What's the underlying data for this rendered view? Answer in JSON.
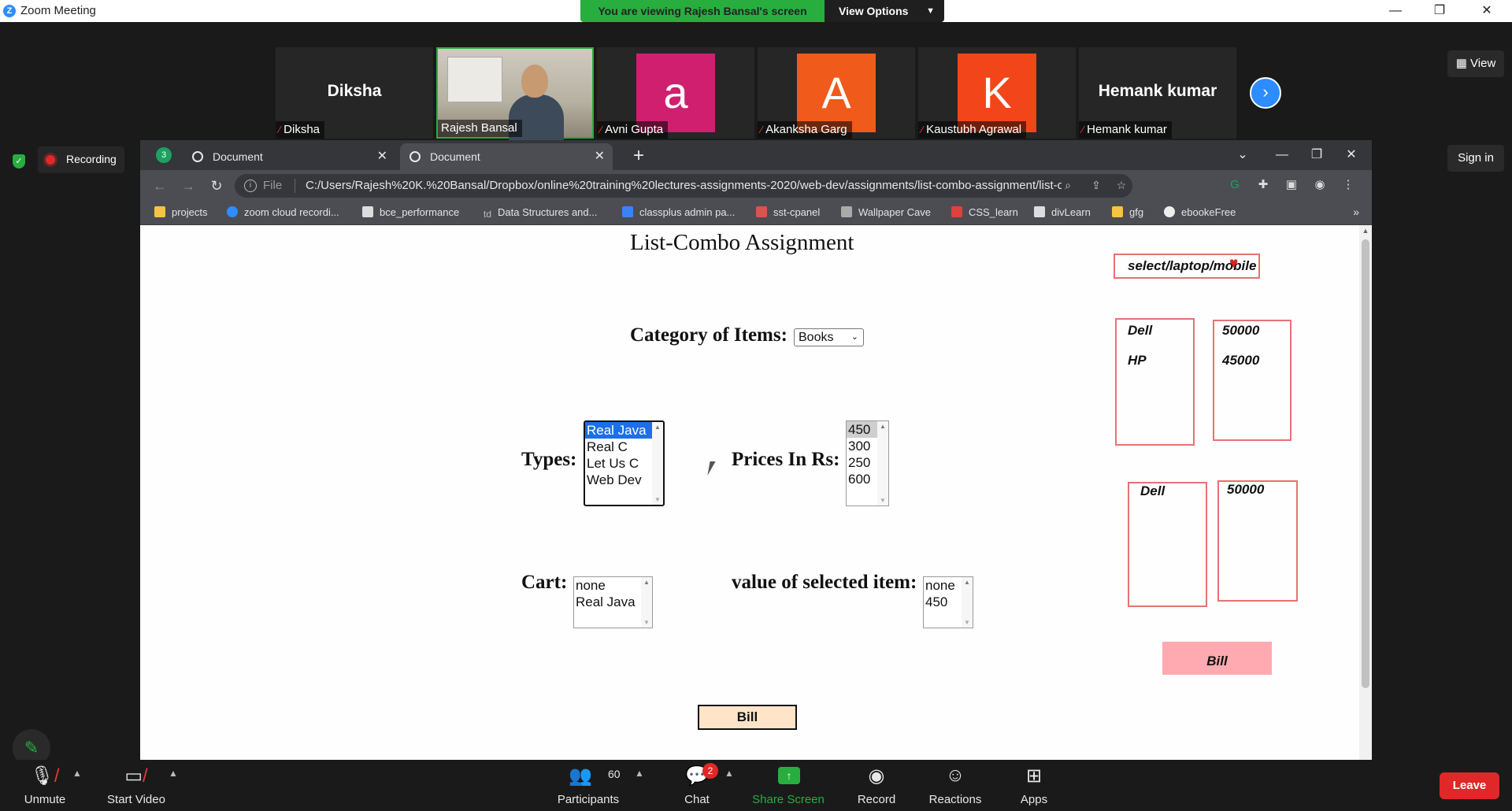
{
  "zoom": {
    "window_title": "Zoom Meeting",
    "viewing_banner": "You are viewing Rajesh Bansal's screen",
    "view_options_label": "View Options",
    "view_button_label": "View",
    "sign_in_label": "Sign in",
    "recording_label": "Recording",
    "participants": [
      {
        "big_name": "Diksha",
        "label": "Diksha"
      },
      {
        "video": true,
        "label": "Rajesh Bansal"
      },
      {
        "avatar_letter": "a",
        "avatar_color": "#cf1f6e",
        "label": "Avni Gupta"
      },
      {
        "avatar_letter": "A",
        "avatar_color": "#f05a1a",
        "label": "Akanksha Garg"
      },
      {
        "avatar_letter": "K",
        "avatar_color": "#f2461a",
        "label": "Kaustubh Agrawal"
      },
      {
        "big_name": "Hemank kumar",
        "label": "Hemank kumar"
      }
    ],
    "toolbar": {
      "unmute": "Unmute",
      "start_video": "Start Video",
      "participants": "Participants",
      "participants_count": "60",
      "chat": "Chat",
      "chat_badge": "2",
      "share_screen": "Share Screen",
      "record": "Record",
      "reactions": "Reactions",
      "apps": "Apps",
      "leave": "Leave"
    }
  },
  "browser": {
    "tab_count": "3",
    "tabs": [
      {
        "title": "Document",
        "active": false
      },
      {
        "title": "Document",
        "active": true
      }
    ],
    "address_scheme": "File",
    "url": "C:/Users/Rajesh%20K.%20Bansal/Dropbox/online%20training%20lectures-assignments-2020/web-dev/assignments/list-combo-assignment/list-co...",
    "bookmarks": [
      {
        "label": "projects",
        "icon_color": "#f6c342"
      },
      {
        "label": "zoom cloud recordi...",
        "icon_color": "#2d8cff"
      },
      {
        "label": "bce_performance",
        "icon_color": "#dddddd"
      },
      {
        "label": "Data Structures and...",
        "icon_color": "#888888",
        "prefix": "td"
      },
      {
        "label": "classplus admin pa...",
        "icon_color": "#3b82f6"
      },
      {
        "label": "sst-cpanel",
        "icon_color": "#d9534f"
      },
      {
        "label": "Wallpaper Cave",
        "icon_color": "#aaaaaa"
      },
      {
        "label": "CSS_learn",
        "icon_color": "#e04040"
      },
      {
        "label": "divLearn",
        "icon_color": "#dddddd"
      },
      {
        "label": "gfg",
        "icon_color": "#f6c342"
      },
      {
        "label": "ebookeFree",
        "icon_color": "#eeeeee"
      }
    ]
  },
  "page": {
    "title": "List-Combo Assignment",
    "category_label": "Category of Items:",
    "category_selected": "Books",
    "types_label": "Types:",
    "types_options": [
      "Real Java",
      "Real C",
      "Let Us C",
      "Web Dev"
    ],
    "prices_label": "Prices In Rs:",
    "prices_options": [
      "450",
      "300",
      "250",
      "600"
    ],
    "cart_label": "Cart:",
    "cart_options": [
      "none",
      "Real Java"
    ],
    "value_label": "value of selected item:",
    "value_options": [
      "none",
      "450"
    ],
    "bill_label": "Bill",
    "sketch": {
      "select_box": "select/laptop/mobile",
      "list_names_1": [
        "Dell",
        "HP"
      ],
      "list_prices_1": [
        "50000",
        "45000"
      ],
      "list_names_2": [
        "Dell"
      ],
      "list_prices_2": [
        "50000"
      ],
      "bill": "Bill"
    }
  }
}
